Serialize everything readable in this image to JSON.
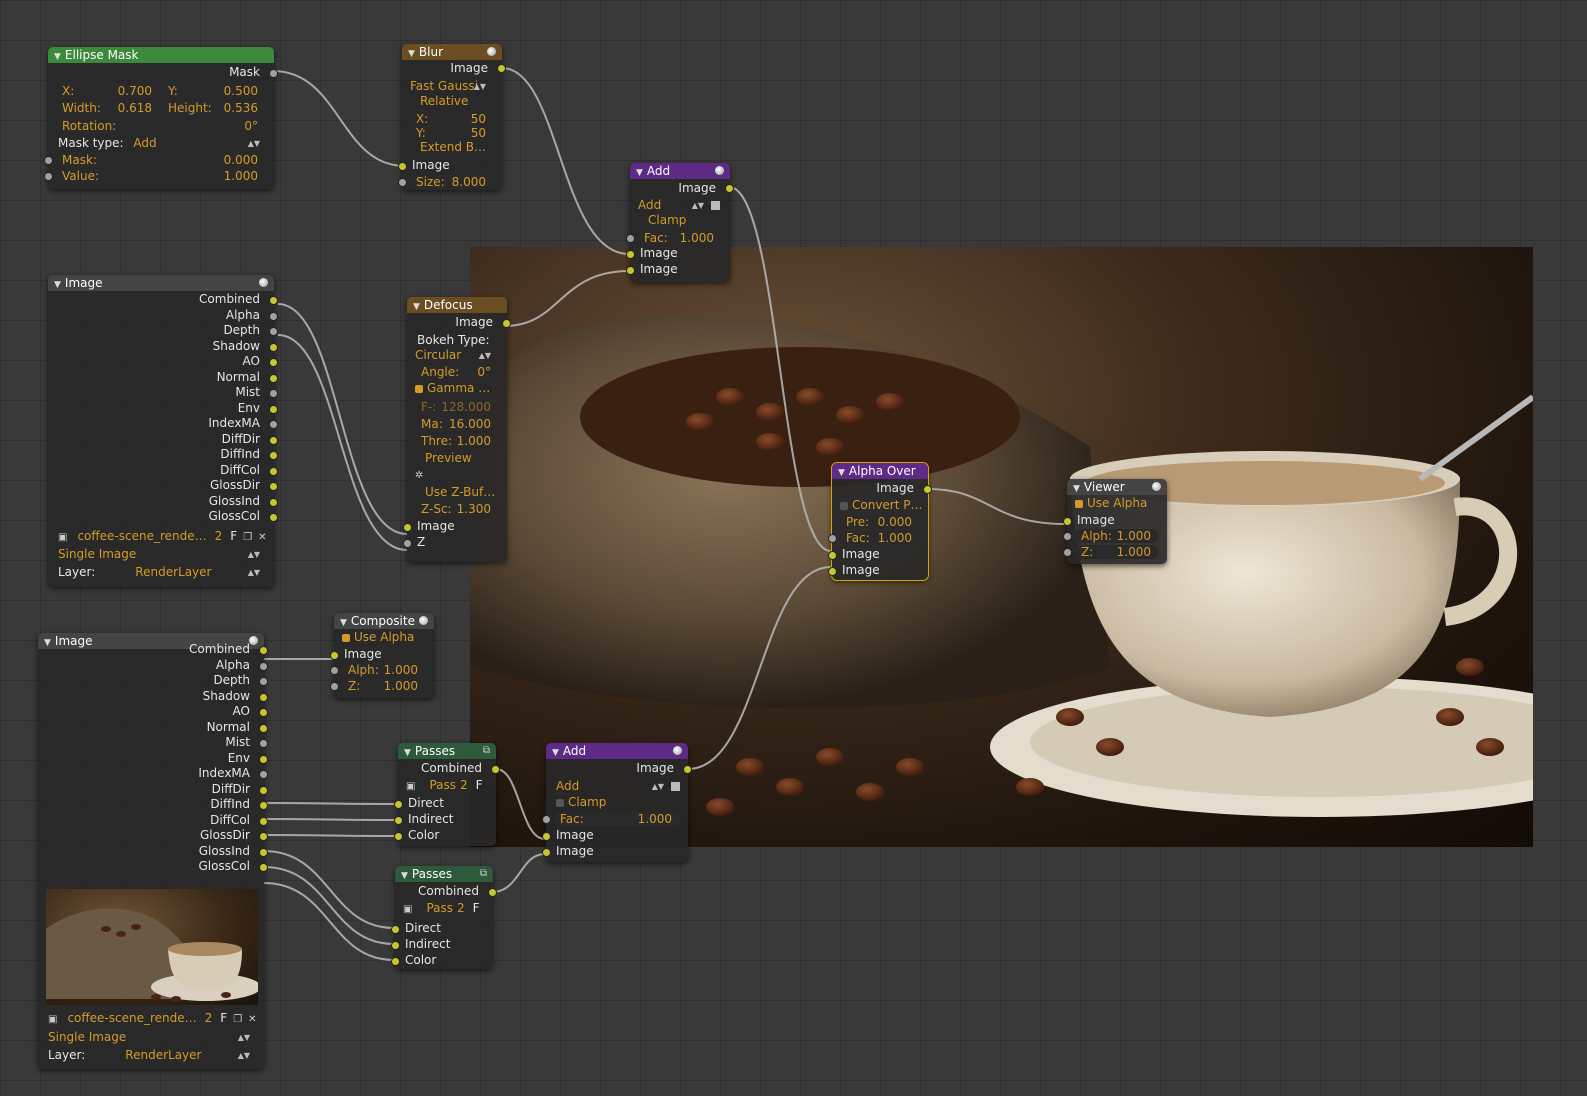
{
  "colors": {
    "socket_color": "#c7c729",
    "socket_value": "#a1a1a1",
    "accent": "#d59b2a",
    "wire": "#b4b4b4"
  },
  "ellipse_mask": {
    "title": "Ellipse Mask",
    "out_mask": "Mask",
    "x_label": "X:",
    "x_val": "0.700",
    "y_label": "Y:",
    "y_val": "0.500",
    "w_label": "Width:",
    "w_val": "0.618",
    "h_label": "Height:",
    "h_val": "0.536",
    "rot_label": "Rotation:",
    "rot_val": "0°",
    "type_label": "Mask type:",
    "type_val": "Add",
    "mask_label": "Mask:",
    "mask_val": "0.000",
    "value_label": "Value:",
    "value_val": "1.000"
  },
  "blur": {
    "title": "Blur",
    "out_image": "Image",
    "filter": "Fast Gaussi",
    "relative": "Relative",
    "x_label": "X:",
    "x_val": "50",
    "y_label": "Y:",
    "y_val": "50",
    "extend": "Extend B…",
    "in_image": "Image",
    "size_label": "Size:",
    "size_val": "8.000"
  },
  "add_top": {
    "title": "Add",
    "out_image": "Image",
    "blend": "Add",
    "clamp": "Clamp",
    "fac_label": "Fac:",
    "fac_val": "1.000",
    "in1": "Image",
    "in2": "Image"
  },
  "image1": {
    "title": "Image",
    "passes": [
      "Combined",
      "Alpha",
      "Depth",
      "Shadow",
      "AO",
      "Normal",
      "Mist",
      "Env",
      "IndexMA",
      "DiffDir",
      "DiffInd",
      "DiffCol",
      "GlossDir",
      "GlossInd",
      "GlossCol"
    ],
    "file": "coffee-scene_rende…",
    "users": "2",
    "fake": "F",
    "source": "Single Image",
    "layer_label": "Layer:",
    "layer_val": "RenderLayer"
  },
  "defocus": {
    "title": "Defocus",
    "out_image": "Image",
    "bokeh_label": "Bokeh Type:",
    "bokeh_val": "Circular",
    "angle_label": "Angle:",
    "angle_val": "0°",
    "gamma": "Gamma …",
    "f_label": "F-:",
    "f_val": "128.000",
    "ma_label": "Ma:",
    "ma_val": "16.000",
    "thr_label": "Thre:",
    "thr_val": "1.000",
    "preview": "Preview",
    "use_z": "Use Z-Buf…",
    "zs_label": "Z-Sc:",
    "zs_val": "1.300",
    "in_image": "Image",
    "in_z": "Z"
  },
  "alpha_over": {
    "title": "Alpha Over",
    "out_image": "Image",
    "convert": "Convert P…",
    "pre_label": "Pre:",
    "pre_val": "0.000",
    "fac_label": "Fac:",
    "fac_val": "1.000",
    "in1": "Image",
    "in2": "Image"
  },
  "viewer": {
    "title": "Viewer",
    "use_alpha": "Use Alpha",
    "in_image": "Image",
    "alpha_label": "Alph:",
    "alpha_val": "1.000",
    "z_label": "Z:",
    "z_val": "1.000"
  },
  "composite": {
    "title": "Composite",
    "use_alpha": "Use Alpha",
    "in_image": "Image",
    "alpha_label": "Alph:",
    "alpha_val": "1.000",
    "z_label": "Z:",
    "z_val": "1.000"
  },
  "image2": {
    "title": "Image",
    "passes": [
      "Combined",
      "Alpha",
      "Depth",
      "Shadow",
      "AO",
      "Normal",
      "Mist",
      "Env",
      "IndexMA",
      "DiffDir",
      "DiffInd",
      "DiffCol",
      "GlossDir",
      "GlossInd",
      "GlossCol"
    ],
    "file": "coffee-scene_rende…",
    "users": "2",
    "fake": "F",
    "source": "Single Image",
    "layer_label": "Layer:",
    "layer_val": "RenderLayer"
  },
  "passes1": {
    "title": "Passes",
    "out": "Combined",
    "pass": "Pass",
    "num": "2",
    "fake": "F",
    "in1": "Direct",
    "in2": "Indirect",
    "in3": "Color"
  },
  "passes2": {
    "title": "Passes",
    "out": "Combined",
    "pass": "Pass",
    "num": "2",
    "fake": "F",
    "in1": "Direct",
    "in2": "Indirect",
    "in3": "Color"
  },
  "add_bottom": {
    "title": "Add",
    "out_image": "Image",
    "blend": "Add",
    "clamp": "Clamp",
    "fac_label": "Fac:",
    "fac_val": "1.000",
    "in1": "Image",
    "in2": "Image"
  }
}
